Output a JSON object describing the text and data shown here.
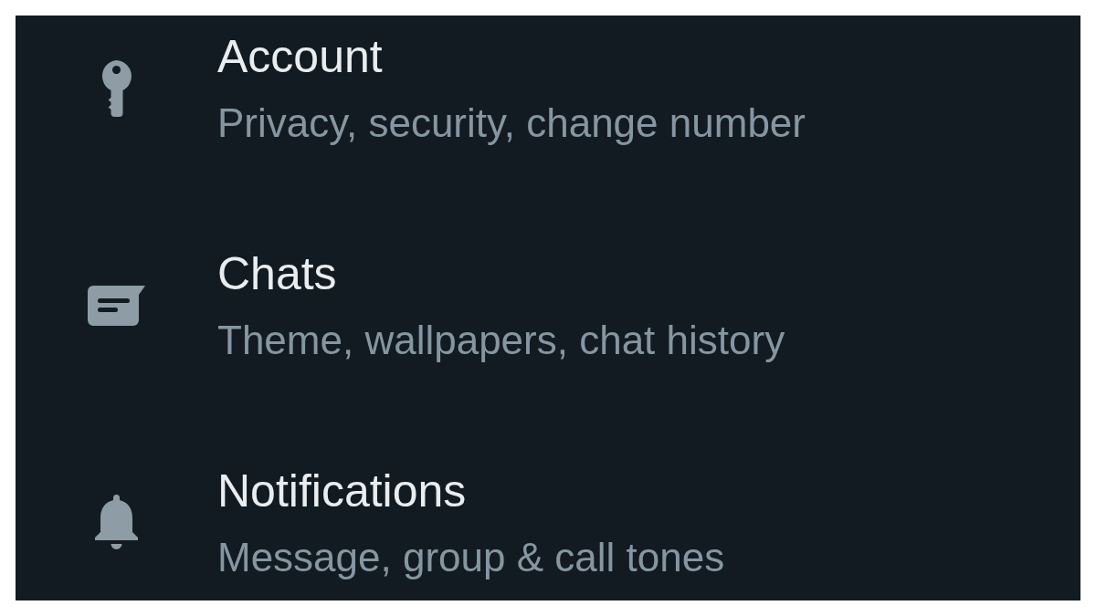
{
  "settings": [
    {
      "title": "Account",
      "subtitle": "Privacy, security, change number"
    },
    {
      "title": "Chats",
      "subtitle": "Theme, wallpapers, chat history"
    },
    {
      "title": "Notifications",
      "subtitle": "Message, group & call tones"
    }
  ]
}
